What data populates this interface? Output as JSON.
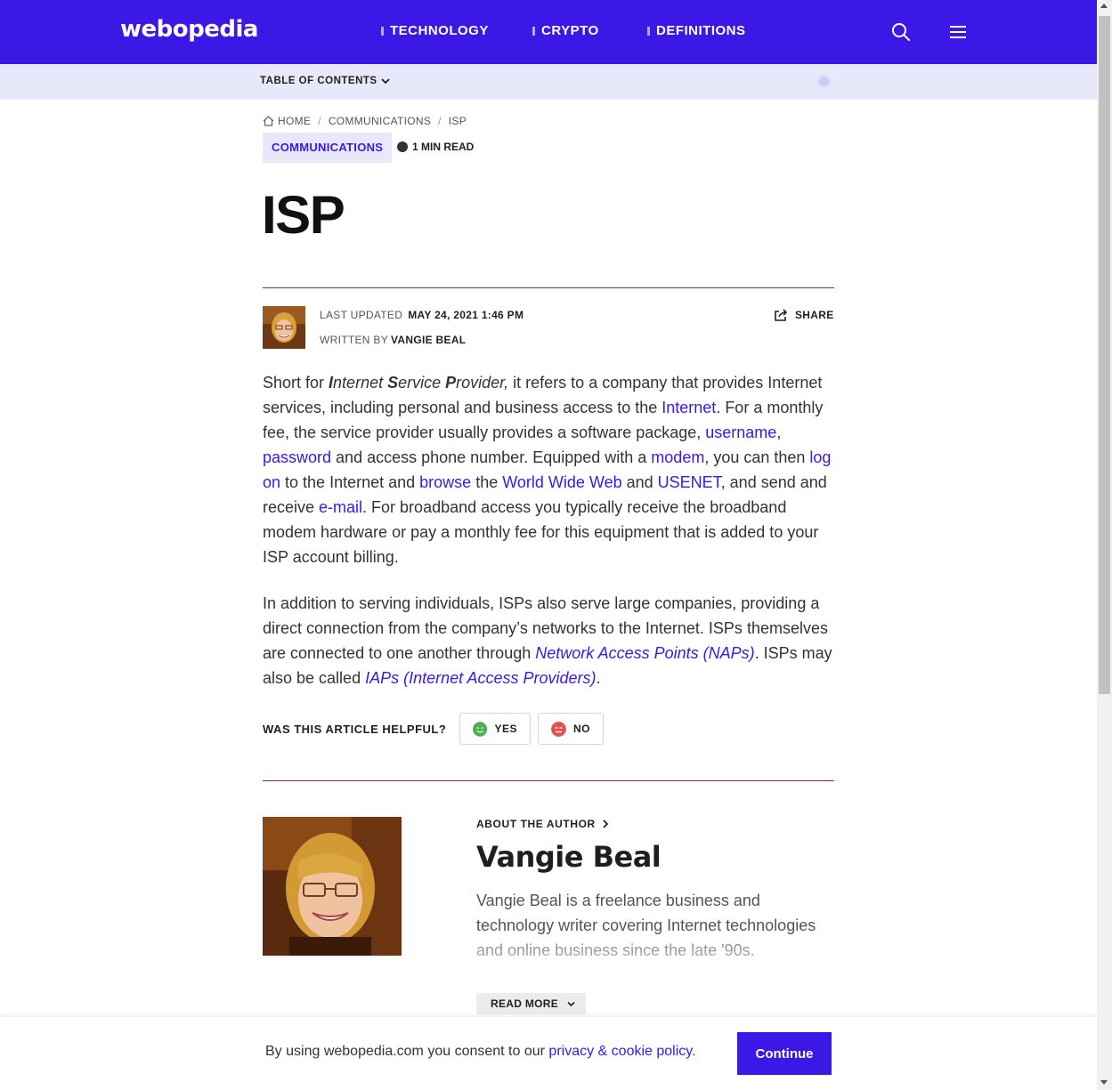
{
  "header": {
    "logo": "webopedia",
    "nav": [
      {
        "label": "TECHNOLOGY"
      },
      {
        "label": "CRYPTO"
      },
      {
        "label": "DEFINITIONS"
      }
    ],
    "icons": [
      "search-icon",
      "menu-icon"
    ],
    "brand_color": "#3b18e6"
  },
  "toc": {
    "label": "TABLE OF CONTENTS"
  },
  "breadcrumb": {
    "home": "HOME",
    "items": [
      "COMMUNICATIONS",
      "ISP"
    ]
  },
  "article": {
    "category": "COMMUNICATIONS",
    "read_time": "1 MIN READ",
    "title": "ISP",
    "last_updated_label": "LAST UPDATED",
    "last_updated_value": "MAY 24, 2021 1:46 PM",
    "written_by_label": "WRITTEN BY",
    "author": "VANGIE BEAL",
    "share_label": "SHARE",
    "p1": {
      "t1": "Short for ",
      "em_i": "I",
      "em_nternet": "nternet ",
      "em_s": "S",
      "em_ervice": "ervice ",
      "em_p": "P",
      "em_rovider": "rovider,",
      "t2": " it refers to a company that provides Internet services, including personal and business access to the ",
      "link_internet": "Internet",
      "t3": ". For a monthly fee, the service provider usually provides a software package, ",
      "link_username": "username",
      "t4": ", ",
      "link_password": "password",
      "t5": " and access phone number. Equipped with a ",
      "link_modem": "modem",
      "t6": ", you can then ",
      "link_logon": "log on",
      "t7": " to the Internet and ",
      "link_browse": "browse",
      "t8": " the ",
      "link_www": "World Wide Web",
      "t9": " and ",
      "link_usenet": "USENET",
      "t10": ", and send and receive ",
      "link_email": "e-mail",
      "t11": ". For broadband access you typically receive the broadband modem hardware or pay a monthly fee for this equipment that is added to your ISP account billing."
    },
    "p2": {
      "t1": "In addition to serving individuals, ISPs also serve large companies, providing a direct connection from the company’s networks to the Internet. ISPs themselves are connected to one another through ",
      "link_naps": "Network Access Points (NAPs)",
      "t2": ". ISPs may also be called ",
      "link_iaps": "IAPs (Internet Access Providers)",
      "t3": "."
    },
    "helpful": {
      "question": "WAS THIS ARTICLE HELPFUL?",
      "yes": "YES",
      "no": "NO"
    }
  },
  "author_box": {
    "about_label": "ABOUT THE AUTHOR",
    "name": "Vangie Beal",
    "bio": "Vangie Beal is a freelance business and technology writer covering Internet technologies and online business since the late '90s.",
    "read_more": "READ MORE"
  },
  "cookie": {
    "text": "By using webopedia.com you consent to our ",
    "link": "privacy & cookie policy",
    "text_end": ".",
    "button": "Continue"
  }
}
